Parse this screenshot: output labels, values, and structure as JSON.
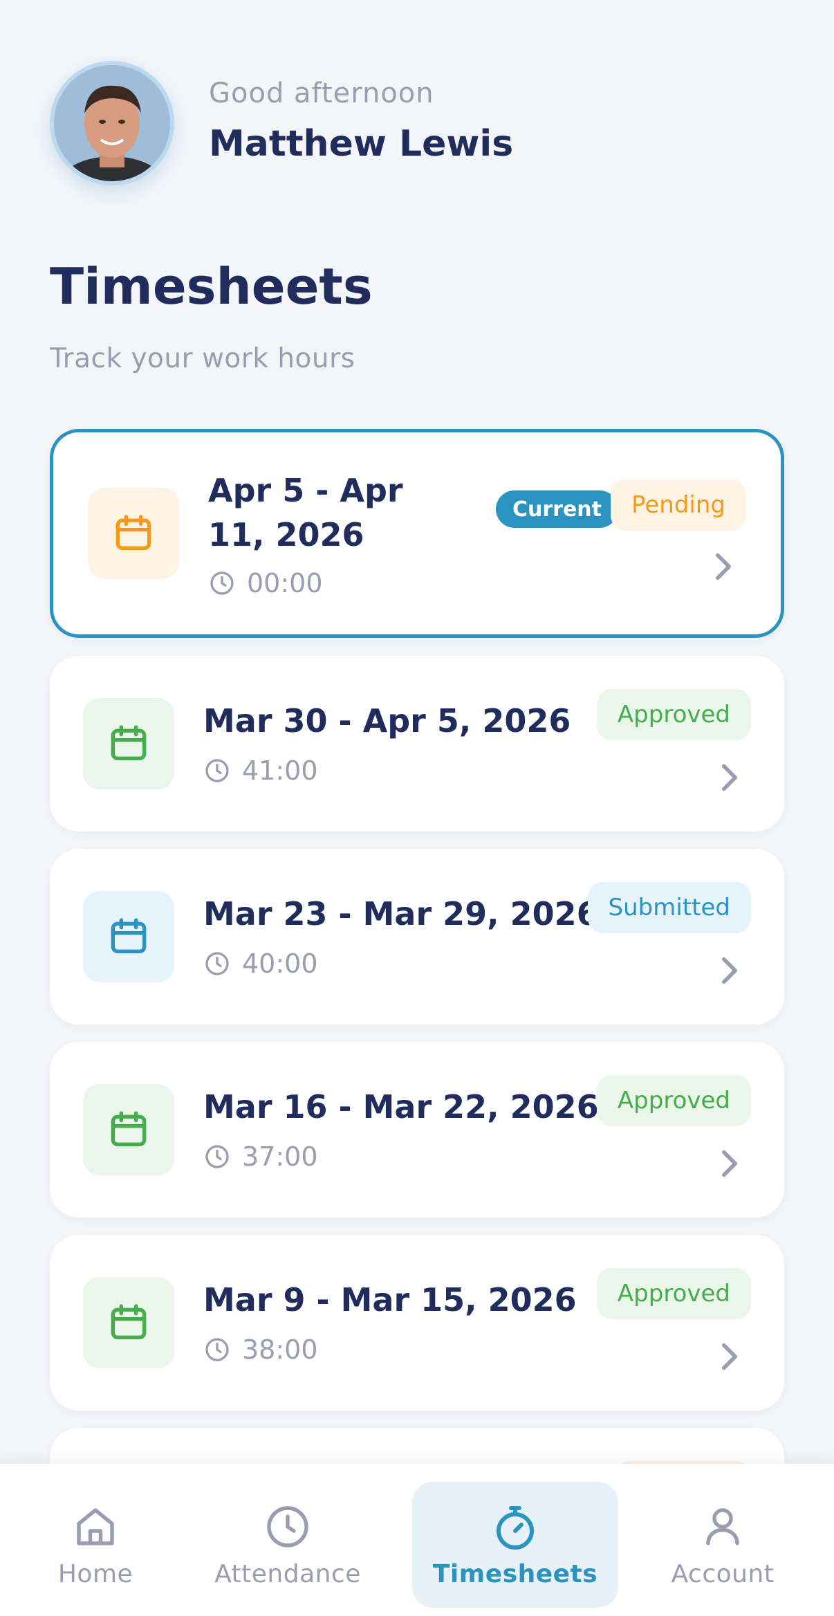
{
  "header": {
    "greeting": "Good afternoon",
    "user_name": "Matthew Lewis"
  },
  "page": {
    "title": "Timesheets",
    "subtitle": "Track your work hours"
  },
  "colors": {
    "accent": "#2a93bf",
    "pending_text": "#f59a16",
    "pending_bg": "#fff3e4",
    "approved_text": "#45ad4c",
    "approved_bg": "#eaf6ea",
    "submitted_text": "#2a93bf",
    "submitted_bg": "#e6f3fa"
  },
  "timesheets": [
    {
      "range": "Apr 5 - Apr 11, 2026",
      "hours": "00:00",
      "status": "Pending",
      "tag": "Current",
      "icon": "calendar-icon"
    },
    {
      "range": "Mar 30 - Apr 5, 2026",
      "hours": "41:00",
      "status": "Approved",
      "icon": "calendar-icon"
    },
    {
      "range": "Mar 23 - Mar 29, 2026",
      "hours": "40:00",
      "status": "Submitted",
      "icon": "calendar-icon"
    },
    {
      "range": "Mar 16 - Mar 22, 2026",
      "hours": "37:00",
      "status": "Approved",
      "icon": "calendar-icon"
    },
    {
      "range": "Mar 9 - Mar 15, 2026",
      "hours": "38:00",
      "status": "Approved",
      "icon": "calendar-icon"
    }
  ],
  "nav": {
    "items": [
      {
        "label": "Home",
        "icon": "home-icon"
      },
      {
        "label": "Attendance",
        "icon": "clock-icon"
      },
      {
        "label": "Timesheets",
        "icon": "stopwatch-icon",
        "active": true
      },
      {
        "label": "Account",
        "icon": "user-icon"
      }
    ]
  }
}
